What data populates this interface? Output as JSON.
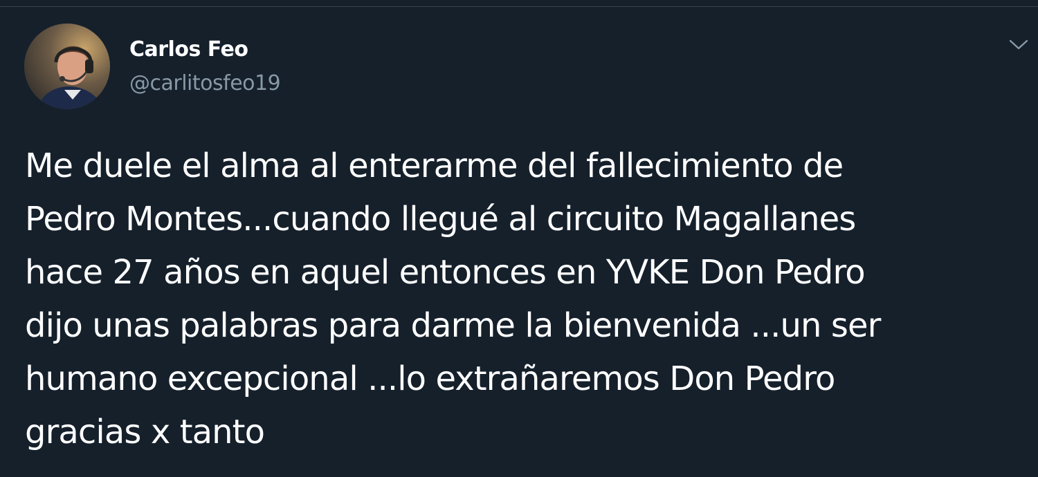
{
  "author": {
    "display_name": "Carlos Feo",
    "handle": "@carlitosfeo19",
    "avatar_icon": "user-avatar-photo"
  },
  "menu": {
    "icon": "chevron-down-icon"
  },
  "tweet": {
    "lines": [
      "Me duele el alma al enterarme del fallecimiento de",
      "Pedro Montes...cuando llegué al circuito Magallanes",
      "hace 27 años en aquel entonces en YVKE Don Pedro",
      "dijo unas palabras para darme la bienvenida ...un ser",
      "humano excepcional ...lo extrañaremos Don Pedro",
      "gracias x tanto"
    ]
  },
  "colors": {
    "background": "#15202b",
    "primary_text": "#ffffff",
    "secondary_text": "#8899a6",
    "border": "#38444d"
  }
}
